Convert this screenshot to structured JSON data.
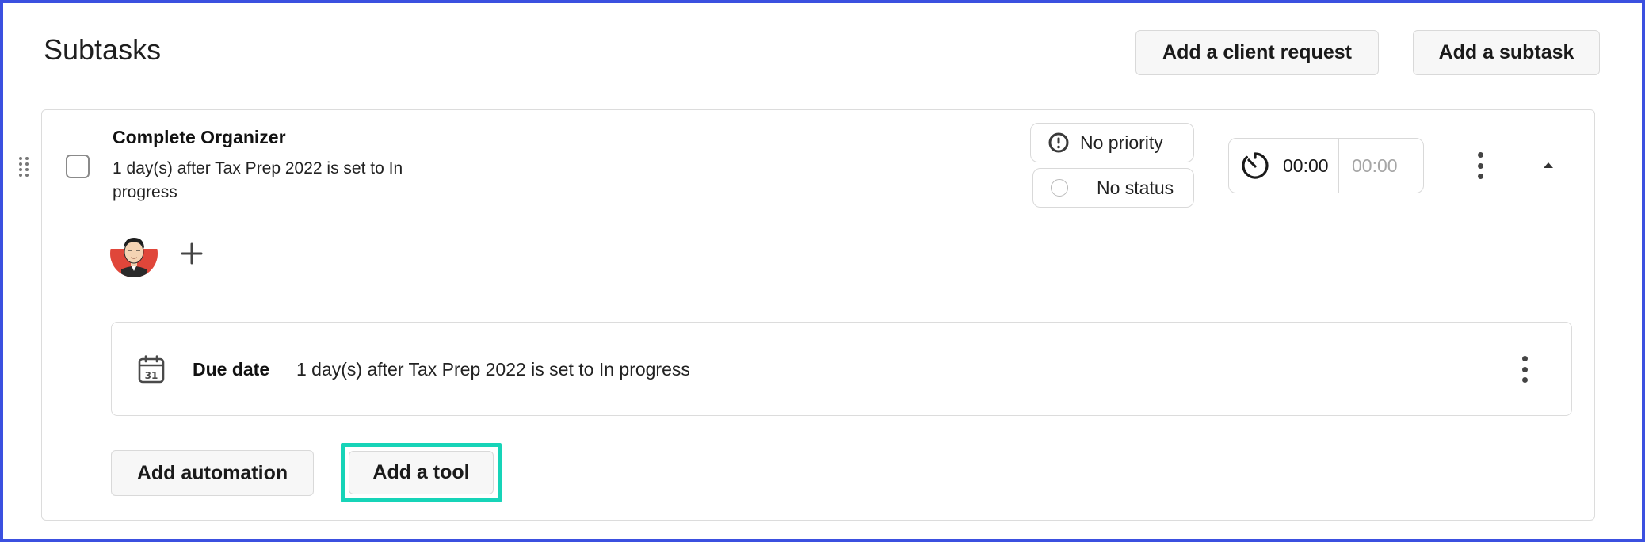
{
  "header": {
    "title": "Subtasks",
    "add_client_request_label": "Add a client request",
    "add_subtask_label": "Add a subtask"
  },
  "subtask": {
    "title": "Complete Organizer",
    "description": "1 day(s) after Tax Prep 2022 is set to In progress",
    "priority_label": "No priority",
    "status_label": "No status",
    "timer": {
      "elapsed": "00:00",
      "estimate": "00:00"
    },
    "due": {
      "label": "Due date",
      "text": "1 day(s) after Tax Prep 2022 is set to In progress",
      "calendar_day": "31"
    },
    "add_automation_label": "Add automation",
    "add_tool_label": "Add a tool"
  },
  "colors": {
    "frame_border": "#3b50e0",
    "highlight": "#17d4b8",
    "avatar_bg": "#e0463a"
  },
  "icons": {
    "drag": "drag-handle-icon",
    "priority": "exclamation-circle-icon",
    "timer": "stopwatch-icon",
    "more": "kebab-menu-icon",
    "collapse": "caret-up-icon",
    "add": "plus-icon",
    "calendar": "calendar-icon"
  }
}
